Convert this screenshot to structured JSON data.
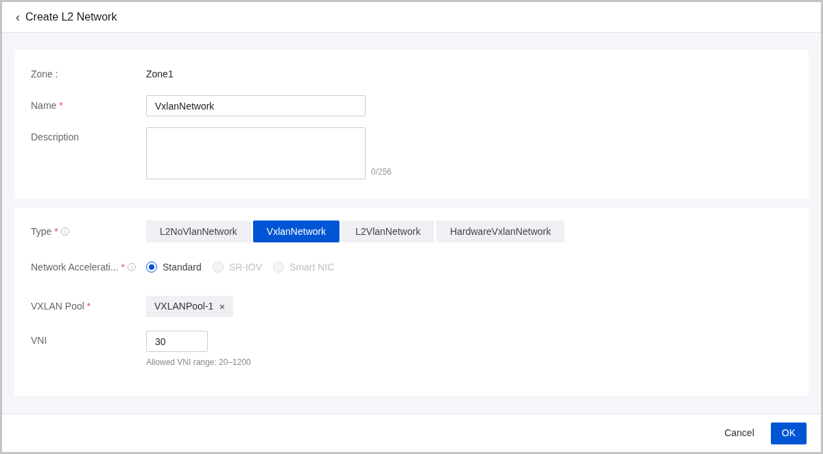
{
  "header": {
    "back_icon": "‹",
    "title": "Create L2 Network"
  },
  "basic": {
    "zone": {
      "label": "Zone :",
      "value": "Zone1"
    },
    "name": {
      "label": "Name",
      "required_mark": "*",
      "value": "VxlanNetwork"
    },
    "description": {
      "label": "Description",
      "counter": "0/256"
    }
  },
  "network": {
    "type": {
      "label": "Type",
      "required_mark": "*",
      "info": true,
      "options": [
        {
          "label": "L2NoVlanNetwork",
          "selected": false
        },
        {
          "label": "VxlanNetwork",
          "selected": true
        },
        {
          "label": "L2VlanNetwork",
          "selected": false
        },
        {
          "label": "HardwareVxlanNetwork",
          "selected": false
        }
      ]
    },
    "acceleration": {
      "label": "Network Accelerati...",
      "required_mark": "*",
      "info": true,
      "options": [
        {
          "label": "Standard",
          "selected": true,
          "disabled": false
        },
        {
          "label": "SR-IOV",
          "selected": false,
          "disabled": true
        },
        {
          "label": "Smart NIC",
          "selected": false,
          "disabled": true
        }
      ]
    },
    "pool": {
      "label": "VXLAN Pool",
      "required_mark": "*",
      "tags": [
        {
          "label": "VXLANPool-1",
          "remove": "×"
        }
      ]
    },
    "vni": {
      "label": "VNI",
      "value": "30",
      "hint": "Allowed VNI range: 20–1200"
    }
  },
  "footer": {
    "buttons": [
      {
        "label": "Cancel",
        "kind": "secondary"
      },
      {
        "label": "OK",
        "kind": "primary"
      }
    ]
  }
}
